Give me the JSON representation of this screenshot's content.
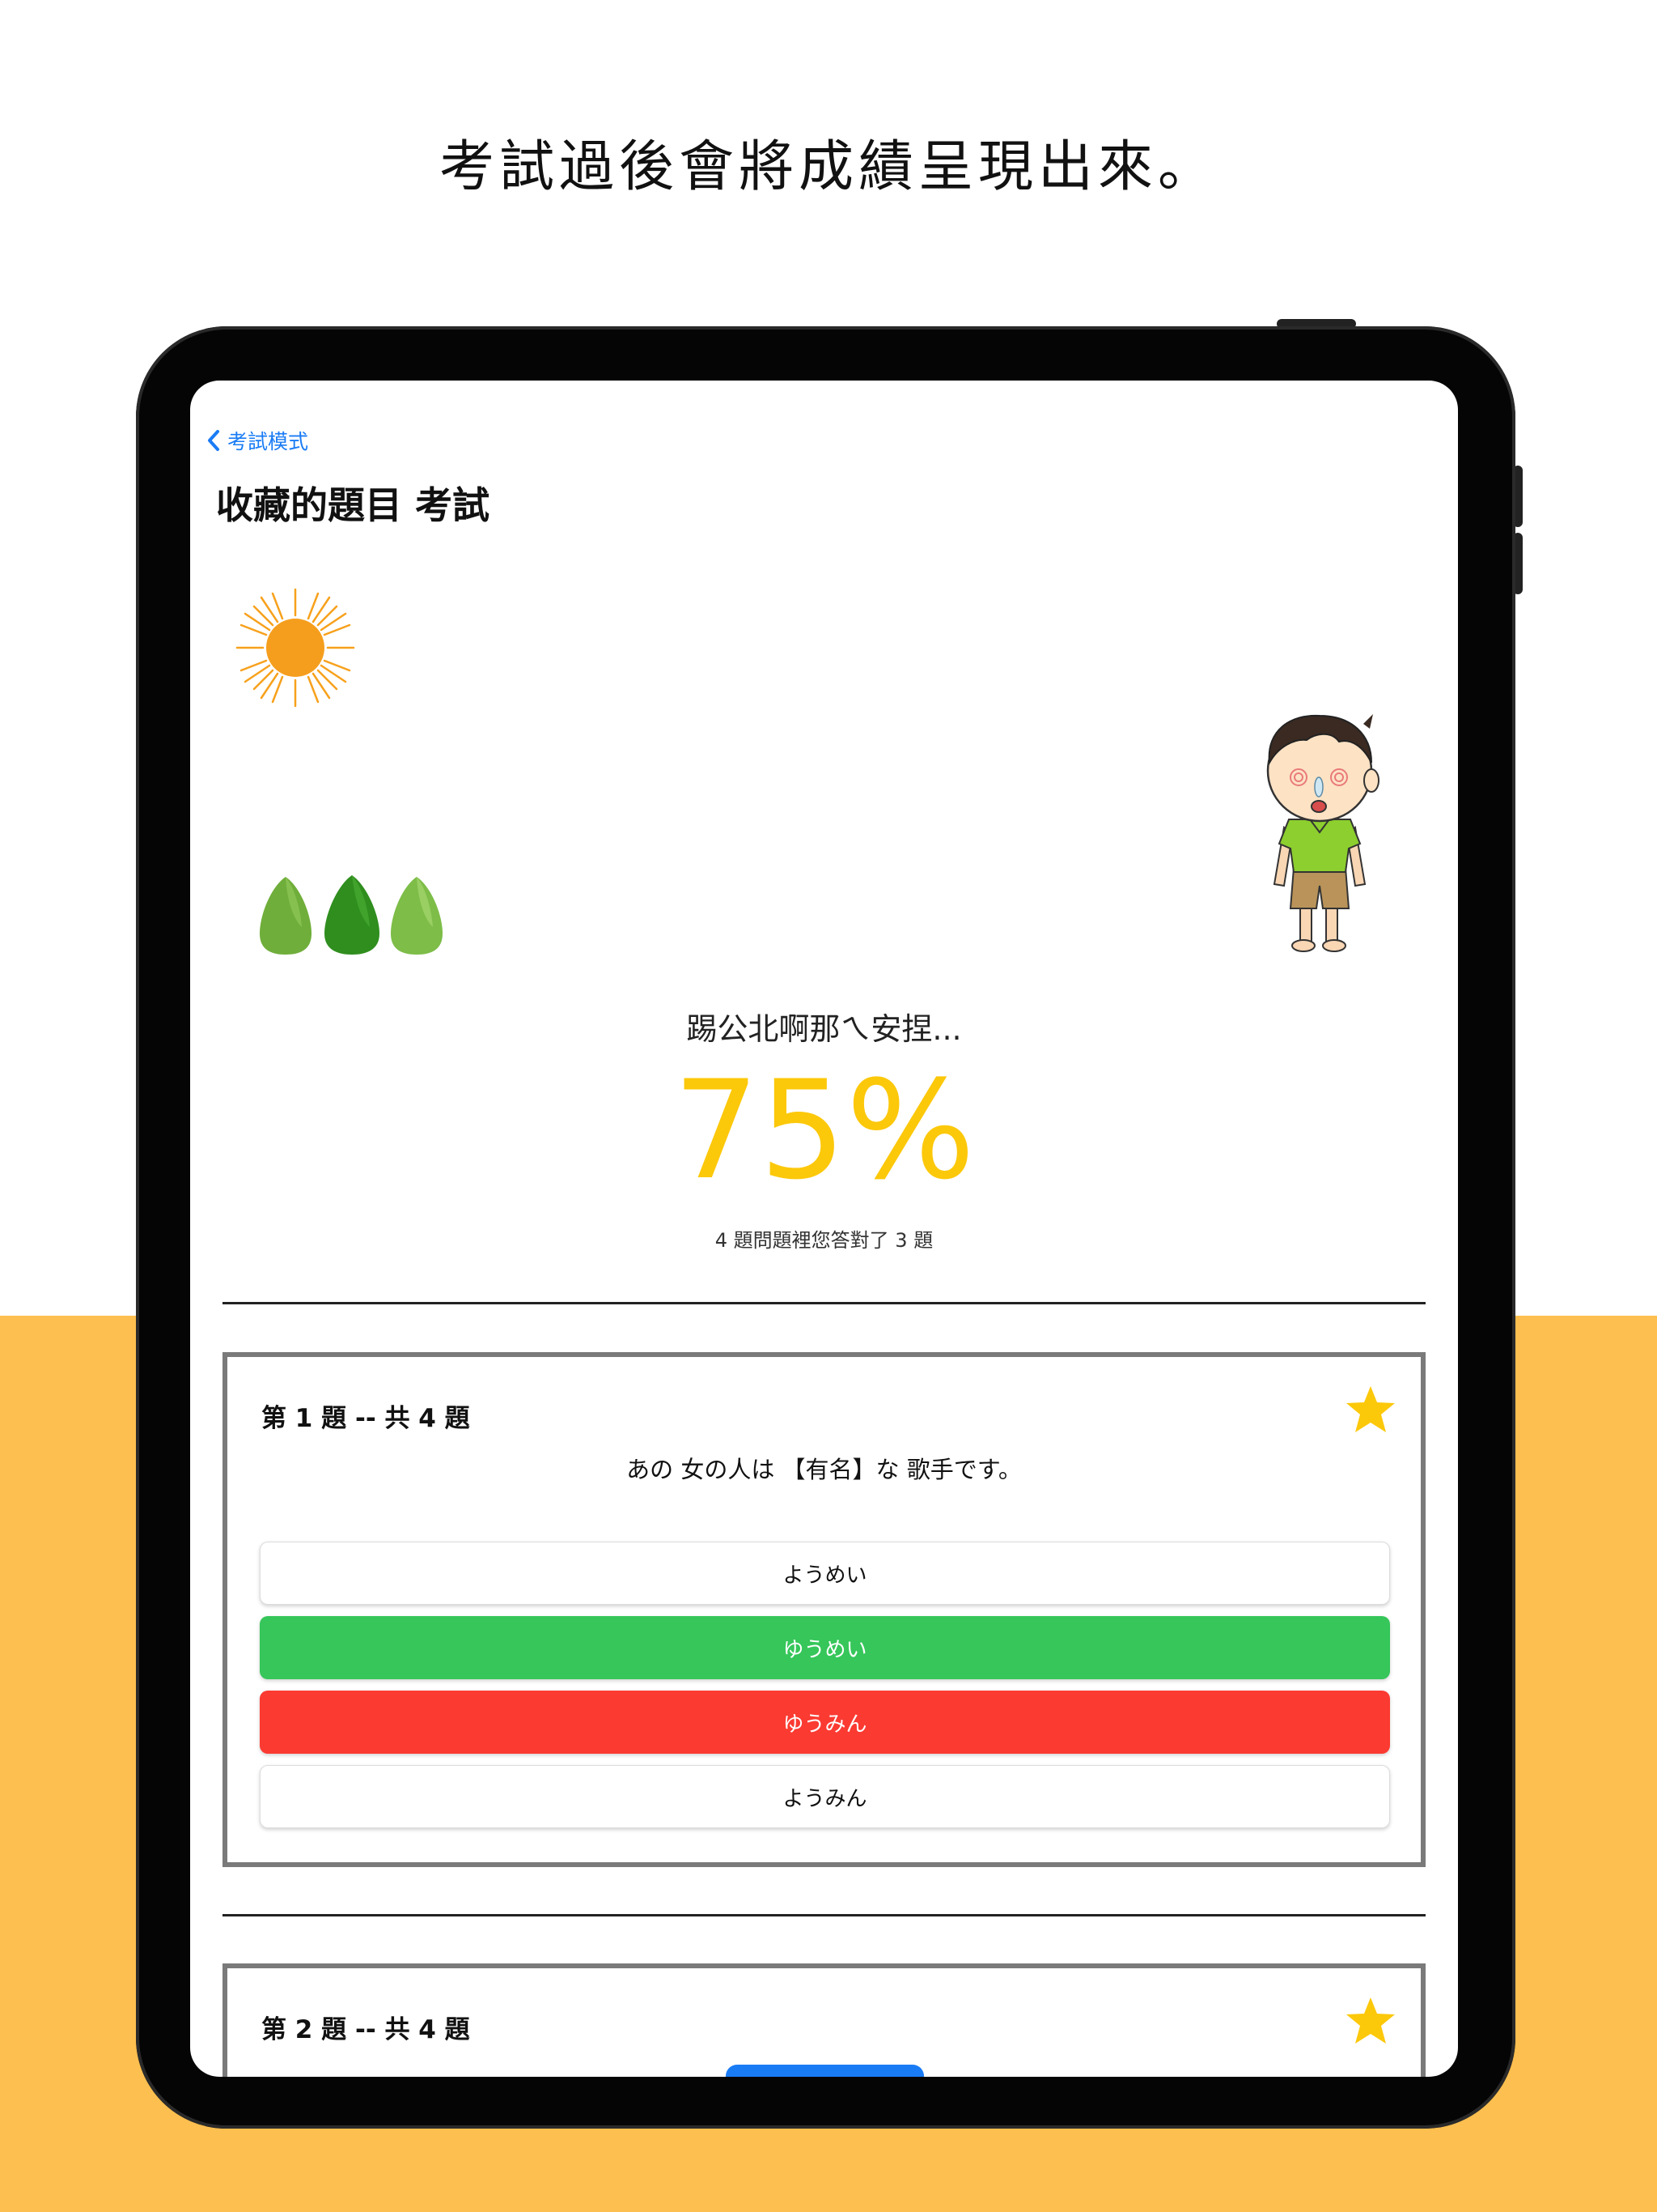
{
  "caption": "考試過後會將成績呈現出來。",
  "nav": {
    "back_label": "考試模式",
    "title": "收藏的題目 考試"
  },
  "result": {
    "message": "踢公北啊那ㄟ安捏...",
    "percent": "75%",
    "summary": "4 題問題裡您答對了 3 題",
    "score_fraction": 0.75
  },
  "questions": [
    {
      "label": "第 1 題 -- 共 4 題",
      "text": "あの 女の人は 【有名】な 歌手です。",
      "options": [
        {
          "text": "ようめい",
          "state": "neutral"
        },
        {
          "text": "ゆうめい",
          "state": "correct"
        },
        {
          "text": "ゆうみん",
          "state": "wrong"
        },
        {
          "text": "ようみん",
          "state": "neutral"
        }
      ]
    },
    {
      "label": "第 2 題 -- 共 4 題"
    }
  ],
  "colors": {
    "accent_yellow": "#fcc80a",
    "band": "#fdbf4f",
    "correct": "#36c65a",
    "wrong": "#fb3a32",
    "link": "#1a7cf5",
    "star": "#fcc80a"
  },
  "icons": [
    "chevron-left-icon",
    "star-icon",
    "sun-icon",
    "tree-icon",
    "kid-character-icon"
  ]
}
